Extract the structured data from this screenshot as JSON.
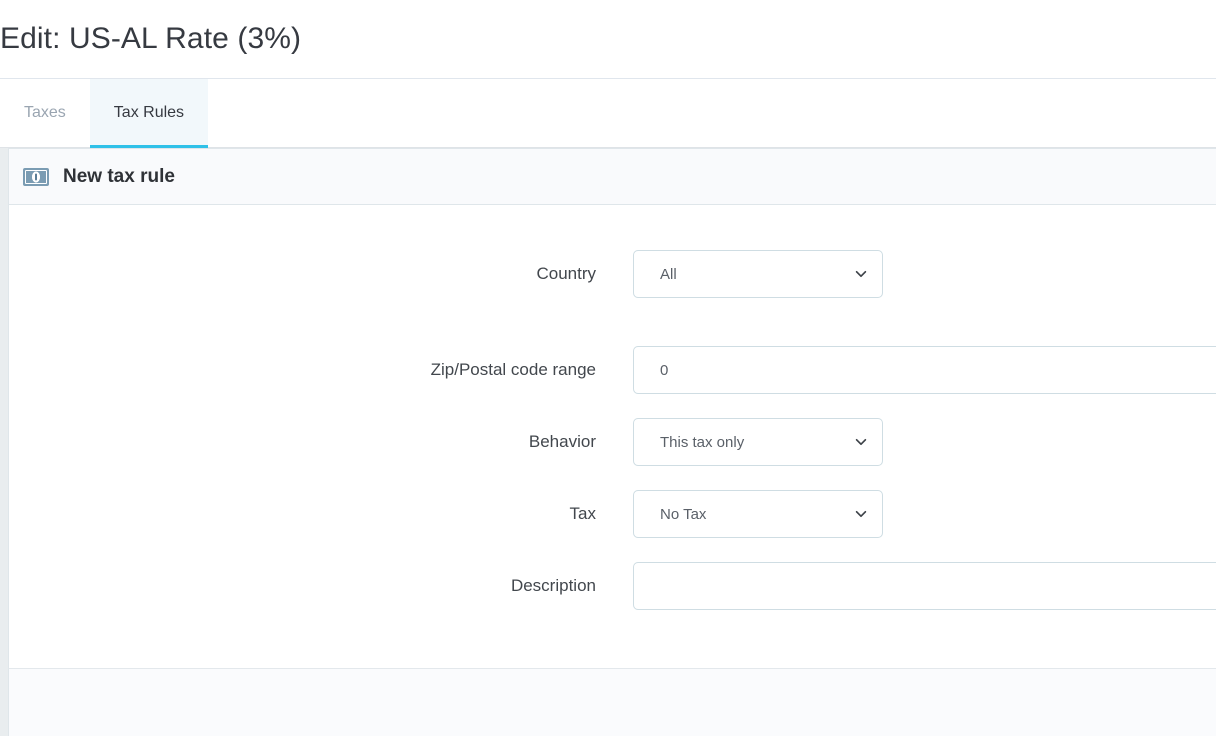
{
  "header": {
    "title": "Edit: US-AL Rate (3%)"
  },
  "tabs": [
    {
      "label": "Taxes",
      "active": false
    },
    {
      "label": "Tax Rules",
      "active": true
    }
  ],
  "panel": {
    "icon": "banknote-icon",
    "title": "New tax rule",
    "fields": [
      {
        "label": "Country",
        "type": "select",
        "value": "All",
        "icon": "chevron-down-icon"
      },
      {
        "label": "Zip/Postal code range",
        "type": "text",
        "value": "0",
        "placeholder": "0"
      },
      {
        "label": "Behavior",
        "type": "select",
        "value": "This tax only",
        "icon": "chevron-down-icon"
      },
      {
        "label": "Tax",
        "type": "select",
        "value": "No Tax",
        "icon": "chevron-down-icon"
      },
      {
        "label": "Description",
        "type": "text",
        "value": "",
        "placeholder": ""
      }
    ]
  },
  "colors": {
    "accent": "#2fc1e8",
    "active_tab_bg": "#f2f8fb",
    "panel_header_bg": "#f9fafc",
    "footer_bg": "#fafbfd",
    "border": "#dfe6ea",
    "label_text": "#42474d",
    "muted_text": "#9aa5b1",
    "icon_fill": "#7b9cb3"
  }
}
